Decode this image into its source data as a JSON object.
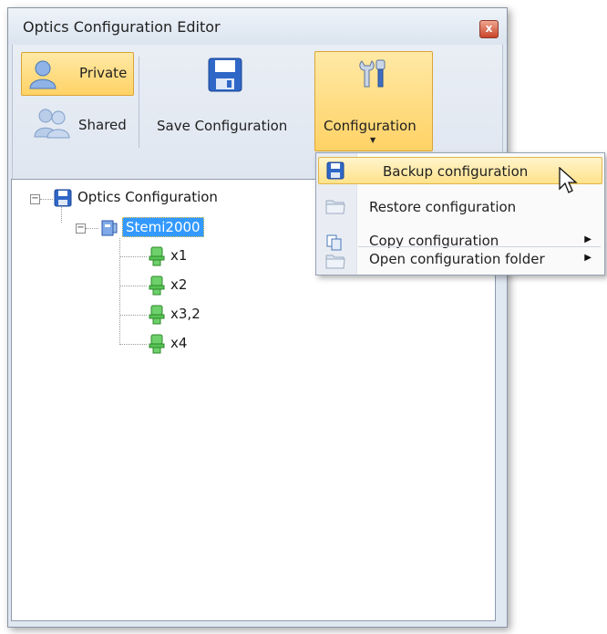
{
  "window": {
    "title": "Optics Configuration Editor",
    "close_glyph": "x"
  },
  "ribbon": {
    "private_label": "Private",
    "shared_label": "Shared",
    "save_label": "Save Configuration",
    "config_label": "Configuration"
  },
  "tree": {
    "root": "Optics Configuration",
    "child": "Stemi2000",
    "items": [
      "x1",
      "x2",
      "x3,2",
      "x4"
    ]
  },
  "menu": {
    "items": [
      {
        "label": "Backup configuration",
        "icon": "save-icon",
        "submenu": false,
        "highlighted": true
      },
      {
        "label": "Restore configuration",
        "icon": "folder-icon",
        "submenu": false
      },
      {
        "label": "Copy configuration",
        "icon": "copy-icon",
        "submenu": true
      },
      {
        "label": "Open configuration folder",
        "icon": "folder-icon",
        "submenu": true
      }
    ]
  },
  "colors": {
    "highlight": "#ffd265",
    "selection": "#3399ff"
  }
}
